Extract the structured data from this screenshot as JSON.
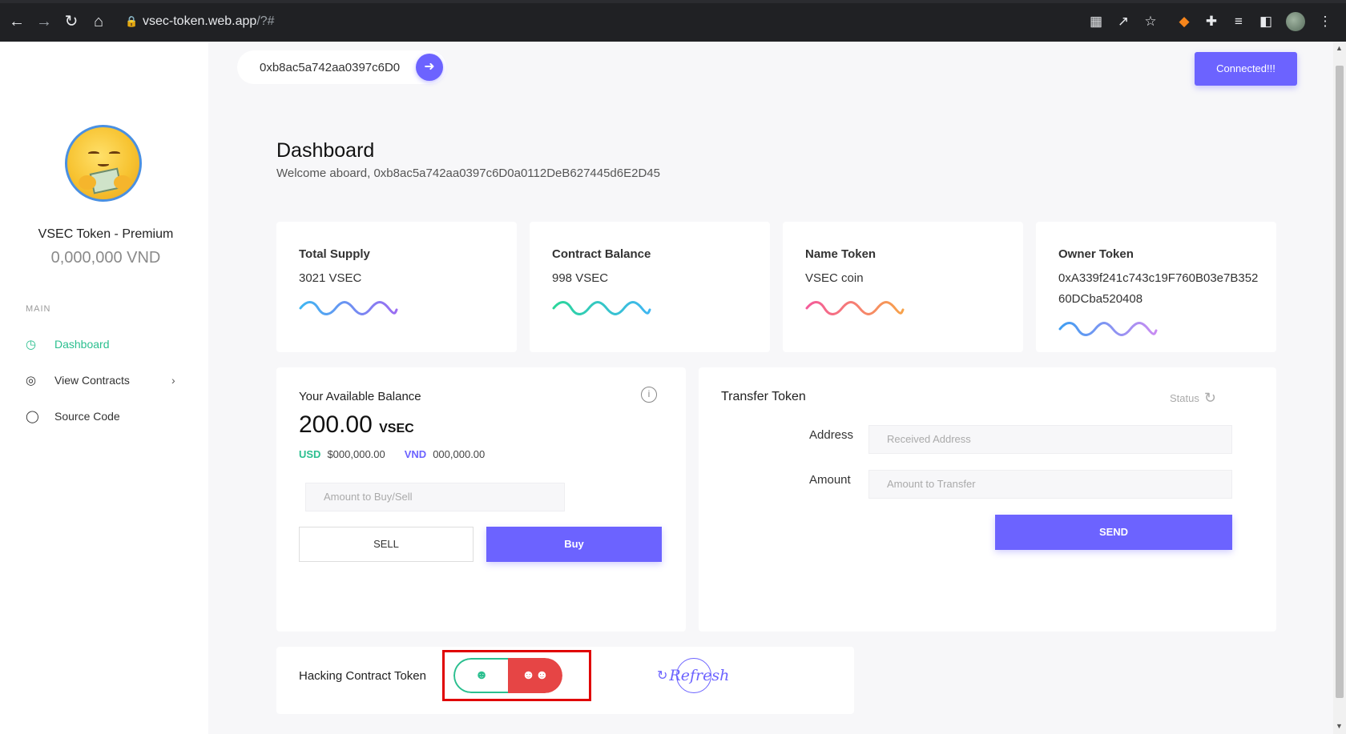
{
  "browser": {
    "url_host": "vsec-token.web.app",
    "url_path": "/?#"
  },
  "topbar": {
    "wallet_short": "0xb8ac5a742aa0397c6D0",
    "connected_label": "Connected!!!"
  },
  "sidebar": {
    "title": "VSEC Token - Premium",
    "amount": "0,000,000 VND",
    "section": "MAIN",
    "items": [
      {
        "label": "Dashboard",
        "icon": "dashboard-icon",
        "active": true
      },
      {
        "label": "View Contracts",
        "icon": "target-icon",
        "active": false
      },
      {
        "label": "Source Code",
        "icon": "circle-icon",
        "active": false
      }
    ]
  },
  "dashboard": {
    "title": "Dashboard",
    "welcome": "Welcome aboard, 0xb8ac5a742aa0397c6D0a0112DeB627445d6E2D45"
  },
  "stats": [
    {
      "label": "Total Supply",
      "value": "3021 VSEC",
      "wave_colors": [
        "#3fb6f2",
        "#9b6cf2"
      ]
    },
    {
      "label": "Contract Balance",
      "value": "998 VSEC",
      "wave_colors": [
        "#2bd69a",
        "#3fb6f2"
      ]
    },
    {
      "label": "Name Token",
      "value": "VSEC coin",
      "wave_colors": [
        "#f45b9a",
        "#f7a24a"
      ]
    },
    {
      "label": "Owner Token",
      "value": "0xA339f241c743c19F760B03e7B35260DCba520408",
      "wave_colors": [
        "#3f9ef2",
        "#c98bf2"
      ]
    }
  ],
  "balance": {
    "label": "Your Available Balance",
    "amount": "200.00",
    "unit": "VSEC",
    "usd_label": "USD",
    "usd_value": "$000,000.00",
    "vnd_label": "VND",
    "vnd_value": "000,000.00",
    "input_placeholder": "Amount to Buy/Sell",
    "sell_label": "SELL",
    "buy_label": "Buy"
  },
  "transfer": {
    "title": "Transfer Token",
    "status_label": "Status",
    "address_label": "Address",
    "address_placeholder": "Received Address",
    "amount_label": "Amount",
    "amount_placeholder": "Amount to Transfer",
    "send_label": "SEND"
  },
  "hacking": {
    "label": "Hacking Contract Token",
    "refresh_label": "Refresh"
  },
  "colors": {
    "accent": "#6c63ff",
    "green": "#2bbf8f",
    "red": "#e64545"
  }
}
